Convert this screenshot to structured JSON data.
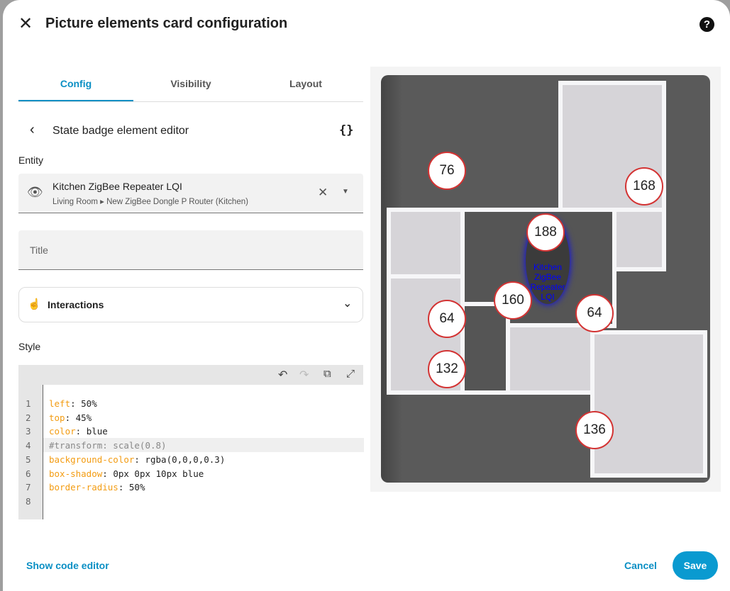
{
  "dialog": {
    "title": "Picture elements card configuration",
    "help": "?"
  },
  "tabs": [
    {
      "label": "Config"
    },
    {
      "label": "Visibility"
    },
    {
      "label": "Layout"
    }
  ],
  "editor": {
    "title": "State badge element editor",
    "yaml_toggle": "{}"
  },
  "entity": {
    "label": "Entity",
    "name": "Kitchen ZigBee Repeater LQI",
    "area": "Living Room",
    "device": "New ZigBee Dongle P Router (Kitchen)"
  },
  "title_field": {
    "placeholder": "Title"
  },
  "interactions": {
    "label": "Interactions"
  },
  "style": {
    "label": "Style",
    "lines": [
      {
        "n": "1",
        "key": "left",
        "val": ": 50%"
      },
      {
        "n": "2",
        "key": "top",
        "val": ": 45%"
      },
      {
        "n": "3",
        "key": "color",
        "val": ": blue"
      },
      {
        "n": "4",
        "comment": "#transform: scale(0.8)"
      },
      {
        "n": "5",
        "key": "background-color",
        "val": ": rgba(0,0,0,0.3)"
      },
      {
        "n": "6",
        "key": "box-shadow",
        "val": ": 0px 0px 10px blue"
      },
      {
        "n": "7",
        "key": "border-radius",
        "val": ": 50%"
      },
      {
        "n": "8"
      }
    ]
  },
  "footer": {
    "show_code": "Show code editor",
    "cancel": "Cancel",
    "save": "Save"
  },
  "preview": {
    "badges": [
      "76",
      "168",
      "188",
      "160",
      "64",
      "64",
      "132",
      "136"
    ],
    "label_lines": [
      "Kitchen",
      "ZigBee",
      "Repeater",
      "LQI"
    ]
  },
  "colors": {
    "accent": "#0a8fc4",
    "badge_border": "#d33333"
  }
}
